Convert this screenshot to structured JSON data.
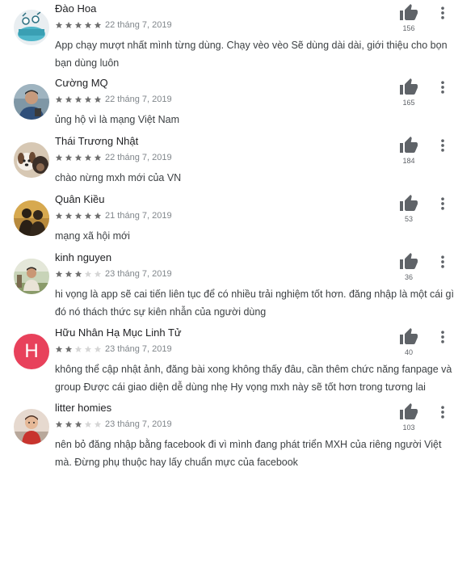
{
  "colors": {
    "star_filled": "#6f6f6f",
    "star_empty": "#d6d6d6",
    "thumb": "#5f6368",
    "avatar_letter_bg": "#e8415b"
  },
  "reviews": [
    {
      "name": "Đào Hoa",
      "rating": 5,
      "date": "22 tháng 7, 2019",
      "text": "App chạy mượt nhất mình từng dùng. Chạy vèo vèo Sẽ dùng dài dài, giới thiệu cho bọn bạn dùng luôn",
      "likes": "156",
      "avatar": "cartoon-character"
    },
    {
      "name": "Cường MQ",
      "rating": 5,
      "date": "22 tháng 7, 2019",
      "text": "ủng hộ vì là mạng Việt Nam",
      "likes": "165",
      "avatar": "man-photo"
    },
    {
      "name": "Thái Trương Nhật",
      "rating": 5,
      "date": "22 tháng 7, 2019",
      "text": "chào nừng mxh mới của VN",
      "likes": "184",
      "avatar": "dog-photo"
    },
    {
      "name": "Quân Kiều",
      "rating": 5,
      "date": "21 tháng 7, 2019",
      "text": "mạng xã hội mới",
      "likes": "53",
      "avatar": "silhouette"
    },
    {
      "name": "kinh nguyen",
      "rating": 3,
      "date": "23 tháng 7, 2019",
      "text": "hi vọng là app sẽ cai tiến liên tục để có nhiều trải nghiệm tốt hơn. đăng nhập là một cái gì đó nó thách thức sự kiên nhẫn của người dùng",
      "likes": "36",
      "avatar": "person-outdoor"
    },
    {
      "name": "Hữu Nhân Hạ Mục Linh Tử",
      "rating": 2,
      "date": "23 tháng 7, 2019",
      "text": "không thể cập nhật ảnh, đăng bài xong không thấy đâu, cần thêm chức năng fanpage và group Được cái giao diện dễ dùng nhẹ Hy vọng mxh này sẽ tốt hơn trong tương lai",
      "likes": "40",
      "avatar": "letter",
      "avatar_letter": "H"
    },
    {
      "name": "litter homies",
      "rating": 3,
      "date": "23 tháng 7, 2019",
      "text": "nên bỏ đăng nhập bằng facebook đi vì mình đang phát triển MXH của riêng người Việt mà. Đừng phụ thuộc hay lấy chuẩn mực của facebook",
      "likes": "103",
      "avatar": "child-photo"
    }
  ]
}
